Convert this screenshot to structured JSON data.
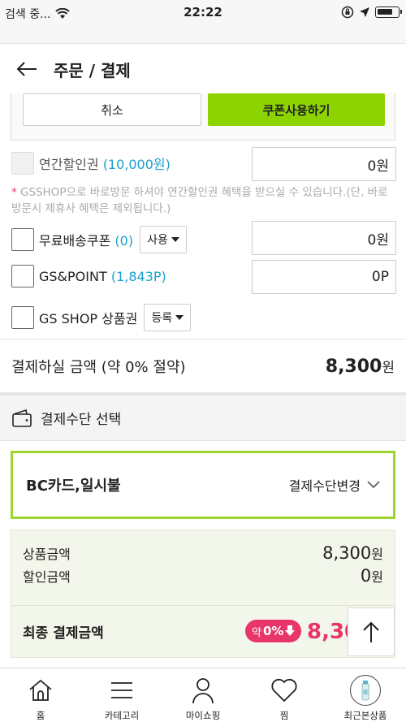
{
  "status_bar": {
    "carrier": "검색 중...",
    "time": "22:22"
  },
  "header": {
    "title": "주문 / 결제"
  },
  "coupon_actions": {
    "cancel_label": "취소",
    "apply_label": "쿠폰사용하기"
  },
  "discounts": {
    "annual": {
      "label": "연간할인권 ",
      "count": "(10,000원)",
      "value": "0원"
    },
    "notice_star": "*",
    "notice": " GSSHOP으로 바로방문 하셔야 연간할인권 혜택을 받으실 수 있습니다.(단, 바로방문시 제휴사 혜택은 제외됩니다.)",
    "free_shipping": {
      "label": "무료배송쿠폰 ",
      "count": "(0)",
      "dropdown": "사용",
      "value": "0원"
    },
    "gs_point": {
      "label": "GS&POINT ",
      "count": "(1,843P)",
      "value": "0P"
    },
    "gift_card": {
      "label": "GS SHOP 상품권",
      "dropdown": "등록"
    }
  },
  "total": {
    "label": "결제하실 금액 (약 0% 절약)",
    "amount": "8,300",
    "unit": "원"
  },
  "payment": {
    "section_title": "결제수단 선택",
    "method": "BC카드,일시불",
    "change_label": "결제수단변경"
  },
  "summary": {
    "product_label": "상품금액",
    "product_amount": "8,300",
    "discount_label": "할인금액",
    "discount_amount": "0",
    "unit": "원",
    "final_label": "최종 결제금액",
    "badge_prefix": "약",
    "badge_value": "0%",
    "final_amount": "8,300원"
  },
  "tabs": [
    {
      "label": "홈",
      "icon": "home-icon"
    },
    {
      "label": "카테고리",
      "icon": "menu-icon"
    },
    {
      "label": "마이쇼핑",
      "icon": "person-icon"
    },
    {
      "label": "찜",
      "icon": "heart-icon"
    },
    {
      "label": "최근본상품",
      "icon": "recent-product-icon"
    }
  ],
  "colors": {
    "accent_green": "#8cd300",
    "accent_blue": "#1a9fcf",
    "accent_pink": "#e8356a"
  }
}
